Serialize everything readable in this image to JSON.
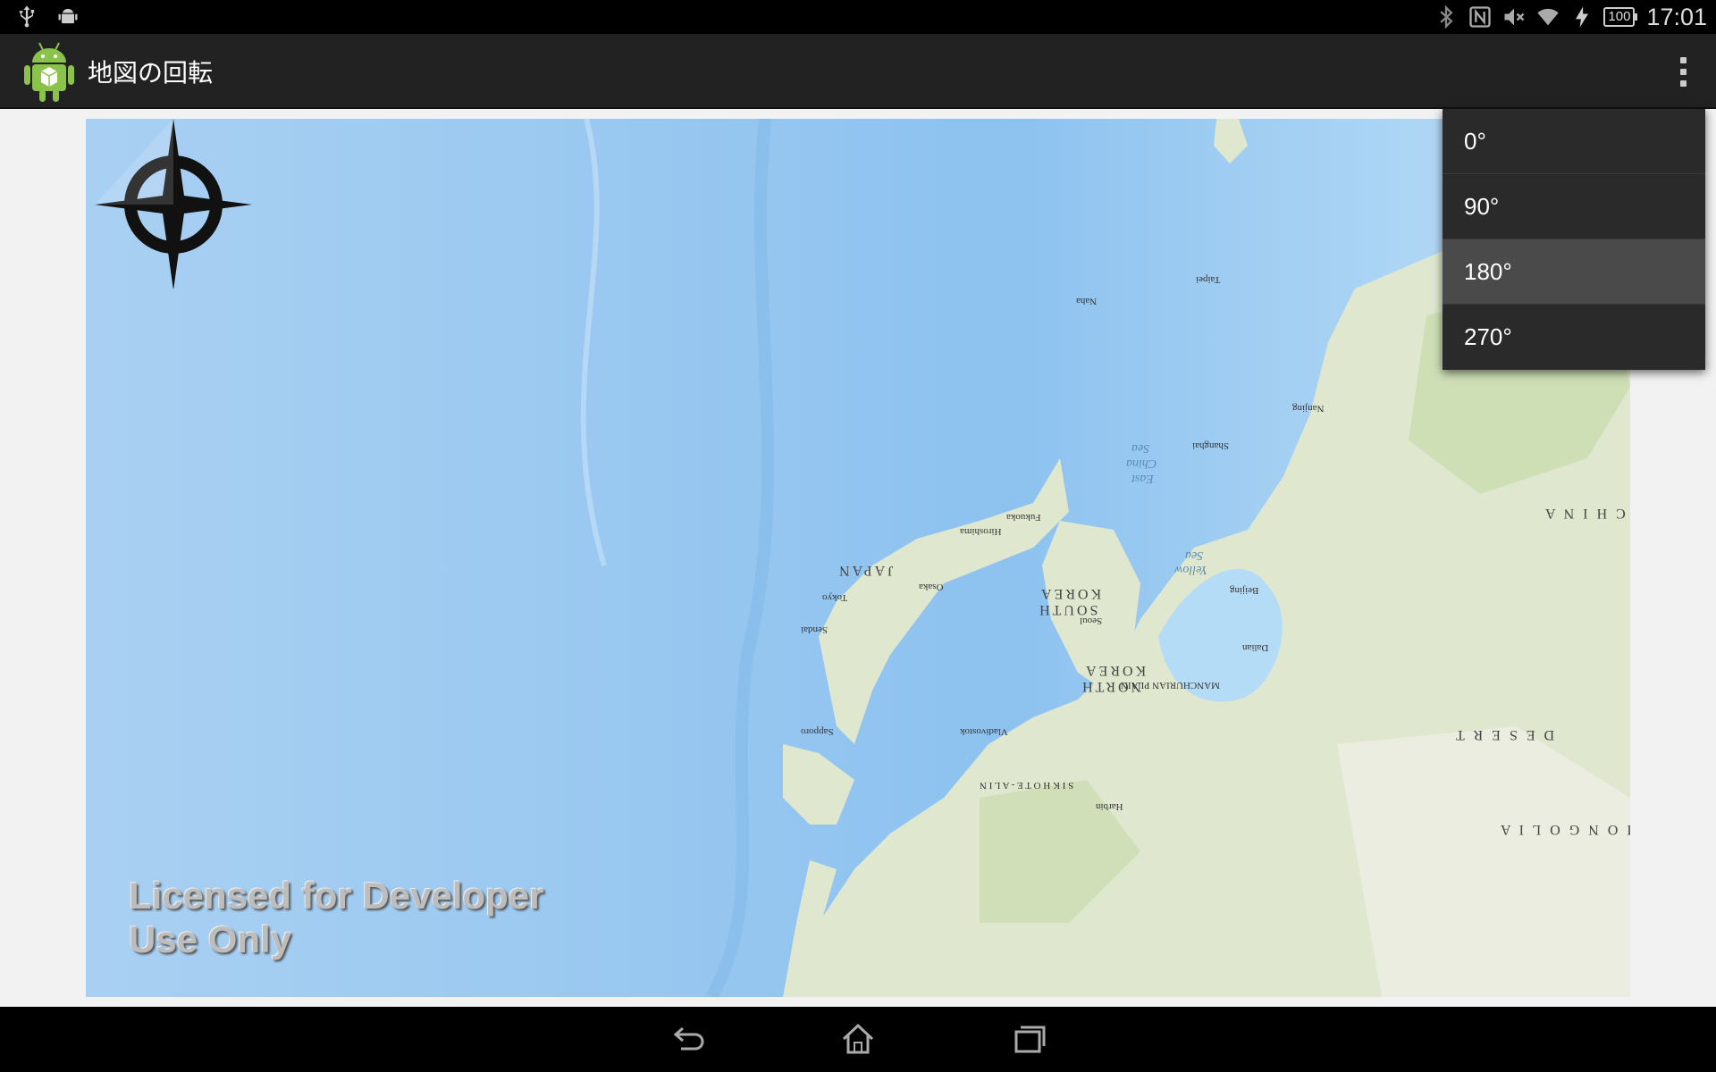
{
  "status_bar": {
    "left_icons": [
      "usb-icon",
      "android-debug-icon"
    ],
    "right_icons": [
      "bluetooth-icon",
      "nfc-icon",
      "volume-muted-icon",
      "wifi-icon",
      "charging-icon"
    ],
    "battery": "100",
    "time": "17:01"
  },
  "action_bar": {
    "app_icon": "android-app-icon",
    "title": "地図の回転",
    "overflow_icon": "overflow-menu-icon"
  },
  "map": {
    "watermark_line1": "Licensed for Developer",
    "watermark_line2": "Use Only",
    "rotation_deg": 180,
    "labels": {
      "japan": "JAPAN",
      "south_korea_1": "SOUTH",
      "south_korea_2": "KOREA",
      "north_korea_1": "NORTH",
      "north_korea_2": "KOREA",
      "east_china_sea_1": "East",
      "east_china_sea_2": "China",
      "east_china_sea_3": "Sea",
      "yellow_sea_1": "Yellow",
      "yellow_sea_2": "Sea",
      "china": "C H I N A",
      "mongolia": "M O N G O L I A",
      "desert": "D E S E R T",
      "manchurian_plain": "MANCHURIAN PLAIN",
      "sikhote_alin": "S I K H O T E - A L I N",
      "tokyo": "Tokyo",
      "osaka": "Osaka",
      "sapporo": "Sapporo",
      "sendai": "Sendai",
      "seoul": "Seoul",
      "beijing": "Beijing",
      "shanghai": "Shanghai",
      "vladivostok": "Vladivostok",
      "harbin": "Harbin",
      "fukuoka": "Fukuoka",
      "naha": "Naha",
      "taipei": "Taipei",
      "dalian": "Dalian",
      "nanjing": "Nanjing",
      "hiroshima": "Hiroshima"
    }
  },
  "menu": {
    "items": [
      "0°",
      "90°",
      "180°",
      "270°"
    ],
    "highlighted_index": 2
  },
  "nav_bar": {
    "buttons": [
      "back-icon",
      "home-icon",
      "recent-apps-icon"
    ]
  },
  "colors": {
    "ocean": "#aed4f3",
    "land": "#dfe8cf",
    "action_bar": "#222222",
    "menu_bg": "#2a2a2a",
    "menu_highlight": "#4a4a4a"
  }
}
